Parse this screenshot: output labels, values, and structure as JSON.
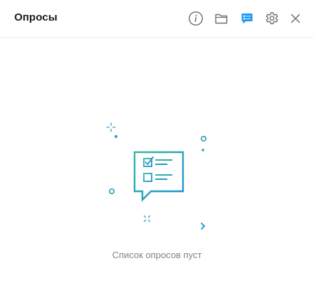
{
  "header": {
    "title": "Опросы"
  },
  "toolbar": {
    "icons": [
      "info-icon",
      "folder-icon",
      "polls-icon",
      "gear-icon",
      "close-icon"
    ],
    "active": "polls-icon"
  },
  "empty_state": {
    "message": "Список опросов пуст"
  },
  "colors": {
    "accent": "#2196f3",
    "illustration_start": "#39b9a0",
    "illustration_end": "#1b8fd6",
    "icon_gray": "#6b6f75",
    "muted_text": "#7d8690"
  }
}
